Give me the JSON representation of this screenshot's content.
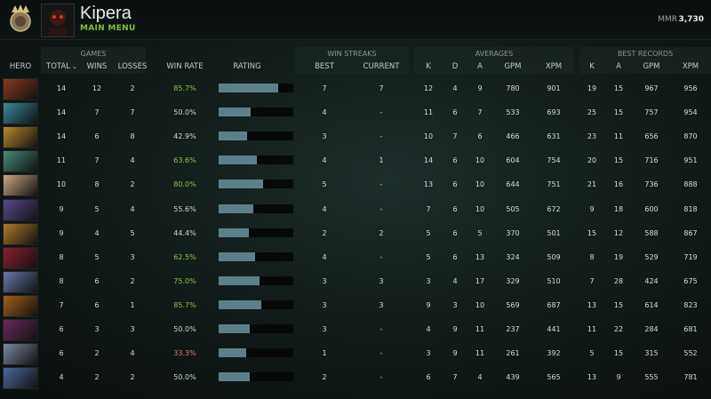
{
  "header": {
    "player_name": "Kipera",
    "main_menu": "MAIN MENU",
    "mmr_label": "MMR",
    "mmr_value": "3,730"
  },
  "groups": {
    "games": "GAMES",
    "win_streaks": "WIN STREAKS",
    "averages": "AVERAGES",
    "best_records": "BEST RECORDS"
  },
  "columns": {
    "hero": "HERO",
    "total": "TOTAL",
    "sort_icon": "sort-desc-icon",
    "wins": "WINS",
    "losses": "LOSSES",
    "win_rate": "WIN RATE",
    "rating": "RATING",
    "best": "BEST",
    "current": "CURRENT",
    "avg_k": "K",
    "avg_d": "D",
    "avg_a": "A",
    "avg_gpm": "GPM",
    "avg_xpm": "XPM",
    "rec_k": "K",
    "rec_a": "A",
    "rec_gpm": "GPM",
    "rec_xpm": "XPM"
  },
  "colors": {
    "win_rate_good": "#8fc24a",
    "win_rate_bad": "#e27a6e",
    "rating_bar": "#5e7e8a",
    "main_menu": "#7fc23a"
  },
  "rows": [
    {
      "hero_color": "#8a3a1e",
      "total": "14",
      "wins": "12",
      "losses": "2",
      "win_rate": "85.7%",
      "wr_class": "good",
      "rating": 0.95,
      "best": "7",
      "current": "7",
      "k": "12",
      "d": "4",
      "a": "9",
      "gpm": "780",
      "xpm": "901",
      "rk": "19",
      "ra": "15",
      "rgpm": "967",
      "rxpm": "956"
    },
    {
      "hero_color": "#3a8a9a",
      "total": "14",
      "wins": "7",
      "losses": "7",
      "win_rate": "50.0%",
      "wr_class": "",
      "rating": 0.52,
      "best": "4",
      "current": "-",
      "k": "11",
      "d": "6",
      "a": "7",
      "gpm": "533",
      "xpm": "693",
      "rk": "25",
      "ra": "15",
      "rgpm": "757",
      "rxpm": "954"
    },
    {
      "hero_color": "#b8872a",
      "total": "14",
      "wins": "6",
      "losses": "8",
      "win_rate": "42.9%",
      "wr_class": "",
      "rating": 0.46,
      "best": "3",
      "current": "-",
      "k": "10",
      "d": "7",
      "a": "6",
      "gpm": "466",
      "xpm": "631",
      "rk": "23",
      "ra": "11",
      "rgpm": "656",
      "rxpm": "870"
    },
    {
      "hero_color": "#4a8a78",
      "total": "11",
      "wins": "7",
      "losses": "4",
      "win_rate": "63.6%",
      "wr_class": "good",
      "rating": 0.62,
      "best": "4",
      "current": "1",
      "k": "14",
      "d": "6",
      "a": "10",
      "gpm": "604",
      "xpm": "754",
      "rk": "20",
      "ra": "15",
      "rgpm": "716",
      "rxpm": "951"
    },
    {
      "hero_color": "#c9a98a",
      "total": "10",
      "wins": "8",
      "losses": "2",
      "win_rate": "80.0%",
      "wr_class": "good",
      "rating": 0.72,
      "best": "5",
      "current": "-",
      "k": "13",
      "d": "6",
      "a": "10",
      "gpm": "644",
      "xpm": "751",
      "rk": "21",
      "ra": "16",
      "rgpm": "736",
      "rxpm": "888"
    },
    {
      "hero_color": "#5a4a8e",
      "total": "9",
      "wins": "5",
      "losses": "4",
      "win_rate": "55.6%",
      "wr_class": "",
      "rating": 0.55,
      "best": "4",
      "current": "-",
      "k": "7",
      "d": "6",
      "a": "10",
      "gpm": "505",
      "xpm": "672",
      "rk": "9",
      "ra": "18",
      "rgpm": "600",
      "rxpm": "818"
    },
    {
      "hero_color": "#b07a2a",
      "total": "9",
      "wins": "4",
      "losses": "5",
      "win_rate": "44.4%",
      "wr_class": "",
      "rating": 0.48,
      "best": "2",
      "current": "2",
      "k": "5",
      "d": "6",
      "a": "5",
      "gpm": "370",
      "xpm": "501",
      "rk": "15",
      "ra": "12",
      "rgpm": "588",
      "rxpm": "867"
    },
    {
      "hero_color": "#8a2030",
      "total": "8",
      "wins": "5",
      "losses": "3",
      "win_rate": "62.5%",
      "wr_class": "good",
      "rating": 0.58,
      "best": "4",
      "current": "-",
      "k": "5",
      "d": "6",
      "a": "13",
      "gpm": "324",
      "xpm": "509",
      "rk": "8",
      "ra": "19",
      "rgpm": "529",
      "rxpm": "719"
    },
    {
      "hero_color": "#6a7aa8",
      "total": "8",
      "wins": "6",
      "losses": "2",
      "win_rate": "75.0%",
      "wr_class": "good",
      "rating": 0.65,
      "best": "3",
      "current": "3",
      "k": "3",
      "d": "4",
      "a": "17",
      "gpm": "329",
      "xpm": "510",
      "rk": "7",
      "ra": "28",
      "rgpm": "424",
      "rxpm": "675"
    },
    {
      "hero_color": "#a0601e",
      "total": "7",
      "wins": "6",
      "losses": "1",
      "win_rate": "85.7%",
      "wr_class": "good",
      "rating": 0.68,
      "best": "3",
      "current": "3",
      "k": "9",
      "d": "3",
      "a": "10",
      "gpm": "569",
      "xpm": "687",
      "rk": "13",
      "ra": "15",
      "rgpm": "614",
      "rxpm": "823"
    },
    {
      "hero_color": "#6a2a5a",
      "total": "6",
      "wins": "3",
      "losses": "3",
      "win_rate": "50.0%",
      "wr_class": "",
      "rating": 0.5,
      "best": "3",
      "current": "-",
      "k": "4",
      "d": "9",
      "a": "11",
      "gpm": "237",
      "xpm": "441",
      "rk": "11",
      "ra": "22",
      "rgpm": "284",
      "rxpm": "681"
    },
    {
      "hero_color": "#7a8aa0",
      "total": "6",
      "wins": "2",
      "losses": "4",
      "win_rate": "33.3%",
      "wr_class": "bad",
      "rating": 0.44,
      "best": "1",
      "current": "-",
      "k": "3",
      "d": "9",
      "a": "11",
      "gpm": "261",
      "xpm": "392",
      "rk": "5",
      "ra": "15",
      "rgpm": "315",
      "rxpm": "552"
    },
    {
      "hero_color": "#4a6a9a",
      "total": "4",
      "wins": "2",
      "losses": "2",
      "win_rate": "50.0%",
      "wr_class": "",
      "rating": 0.5,
      "best": "2",
      "current": "-",
      "k": "6",
      "d": "7",
      "a": "4",
      "gpm": "439",
      "xpm": "565",
      "rk": "13",
      "ra": "9",
      "rgpm": "555",
      "rxpm": "781"
    }
  ]
}
